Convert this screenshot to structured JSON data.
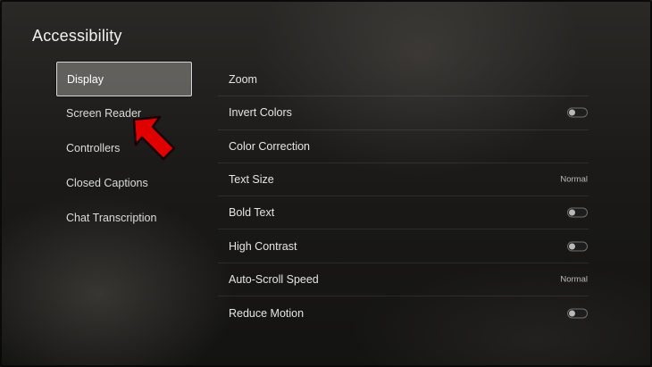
{
  "page": {
    "title": "Accessibility"
  },
  "nav": {
    "items": [
      {
        "label": "Display",
        "selected": true
      },
      {
        "label": "Screen Reader",
        "selected": false
      },
      {
        "label": "Controllers",
        "selected": false
      },
      {
        "label": "Closed Captions",
        "selected": false
      },
      {
        "label": "Chat Transcription",
        "selected": false
      }
    ]
  },
  "settings": {
    "rows": [
      {
        "label": "Zoom",
        "control": "none"
      },
      {
        "label": "Invert Colors",
        "control": "toggle",
        "on": false
      },
      {
        "label": "Color Correction",
        "control": "none"
      },
      {
        "label": "Text Size",
        "control": "value",
        "value": "Normal"
      },
      {
        "label": "Bold Text",
        "control": "toggle",
        "on": false
      },
      {
        "label": "High Contrast",
        "control": "toggle",
        "on": false
      },
      {
        "label": "Auto-Scroll Speed",
        "control": "value",
        "value": "Normal"
      },
      {
        "label": "Reduce Motion",
        "control": "toggle",
        "on": false
      }
    ]
  },
  "annotation": {
    "icon": "red-arrow-icon",
    "color": "#e00000",
    "points_to": "Screen Reader"
  }
}
